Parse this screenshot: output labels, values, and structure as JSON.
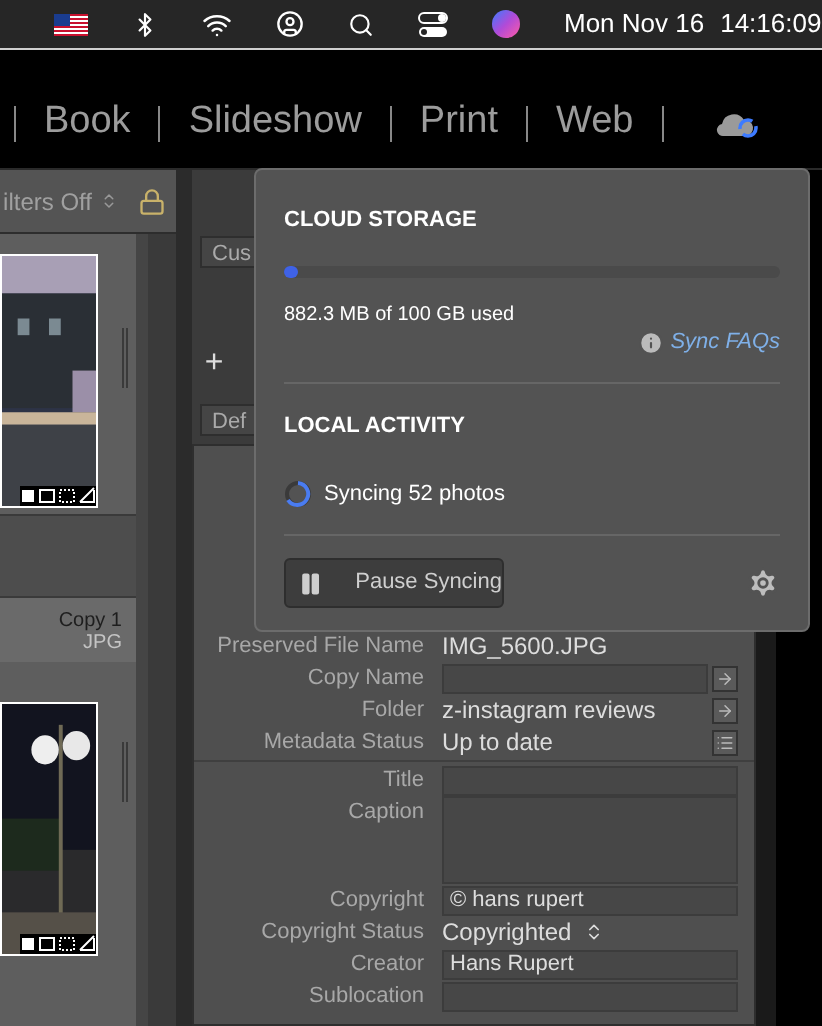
{
  "menu_bar": {
    "date": "Mon Nov 16",
    "time": "14:16:09"
  },
  "modules": [
    "Book",
    "Slideshow",
    "Print",
    "Web"
  ],
  "filter_bar": {
    "label": "ilters Off"
  },
  "filmstrip": {
    "copy_label": "Copy 1",
    "file_type": "JPG"
  },
  "side_buttons": [
    "Cus",
    "+",
    "Def"
  ],
  "metadata": {
    "file_rows": [
      {
        "label": "Preserved File Name",
        "value": "IMG_5600.JPG",
        "kind": "text"
      },
      {
        "label": "Copy Name",
        "kind": "field",
        "action": {
          "kind": "arrow"
        }
      },
      {
        "label": "Folder",
        "value": "z-instagram reviews",
        "kind": "text",
        "action": {
          "kind": "arrow"
        }
      },
      {
        "label": "Metadata Status",
        "value": "Up to date",
        "kind": "text",
        "action": {
          "kind": "list"
        }
      }
    ],
    "info_rows": [
      {
        "label": "Title",
        "kind": "field"
      },
      {
        "label": "Caption",
        "kind": "area"
      },
      {
        "label": "Copyright",
        "value": "© hans rupert",
        "kind": "field"
      },
      {
        "label": "Copyright Status",
        "value": "Copyrighted",
        "kind": "select"
      },
      {
        "label": "Creator",
        "value": "Hans Rupert",
        "kind": "field"
      },
      {
        "label": "Sublocation",
        "kind": "field"
      }
    ]
  },
  "cloud_popover": {
    "storage_title": "CLOUD STORAGE",
    "level": 0.02,
    "usage": "882.3 MB of 100 GB used",
    "link": "Sync FAQs",
    "activity_title": "LOCAL ACTIVITY",
    "status": "Syncing 52 photos",
    "pause_button": "Pause Syncing"
  }
}
